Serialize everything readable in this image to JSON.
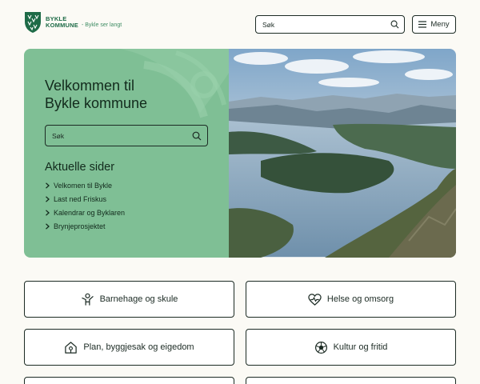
{
  "header": {
    "logo_line1": "BYKLE",
    "logo_line2": "KOMMUNE",
    "tagline": "Bykle ser langt",
    "search_placeholder": "Søk",
    "menu_label": "Meny"
  },
  "hero": {
    "title_line1": "Velkommen til",
    "title_line2": "Bykle kommune",
    "search_placeholder": "Søk",
    "section_title": "Aktuelle sider",
    "links": [
      {
        "label": "Velkomen til Bykle"
      },
      {
        "label": "Last ned Friskus"
      },
      {
        "label": "Kalendrar og Byklaren"
      },
      {
        "label": "Brynjeprosjektet"
      }
    ],
    "image_icon": "landscape-photo"
  },
  "tiles": [
    {
      "label": "Barnehage og skule",
      "icon": "child-icon"
    },
    {
      "label": "Helse og omsorg",
      "icon": "heart-pulse-icon"
    },
    {
      "label": "Plan, byggjesak og eigedom",
      "icon": "house-icon"
    },
    {
      "label": "Kultur og fritid",
      "icon": "ball-icon"
    },
    {
      "label": "",
      "icon": ""
    },
    {
      "label": "",
      "icon": ""
    }
  ],
  "colors": {
    "brand_green": "#1e6b47",
    "hero_green": "#7fbf95",
    "background": "#fbfaf5",
    "text_dark": "#1c2b24"
  }
}
